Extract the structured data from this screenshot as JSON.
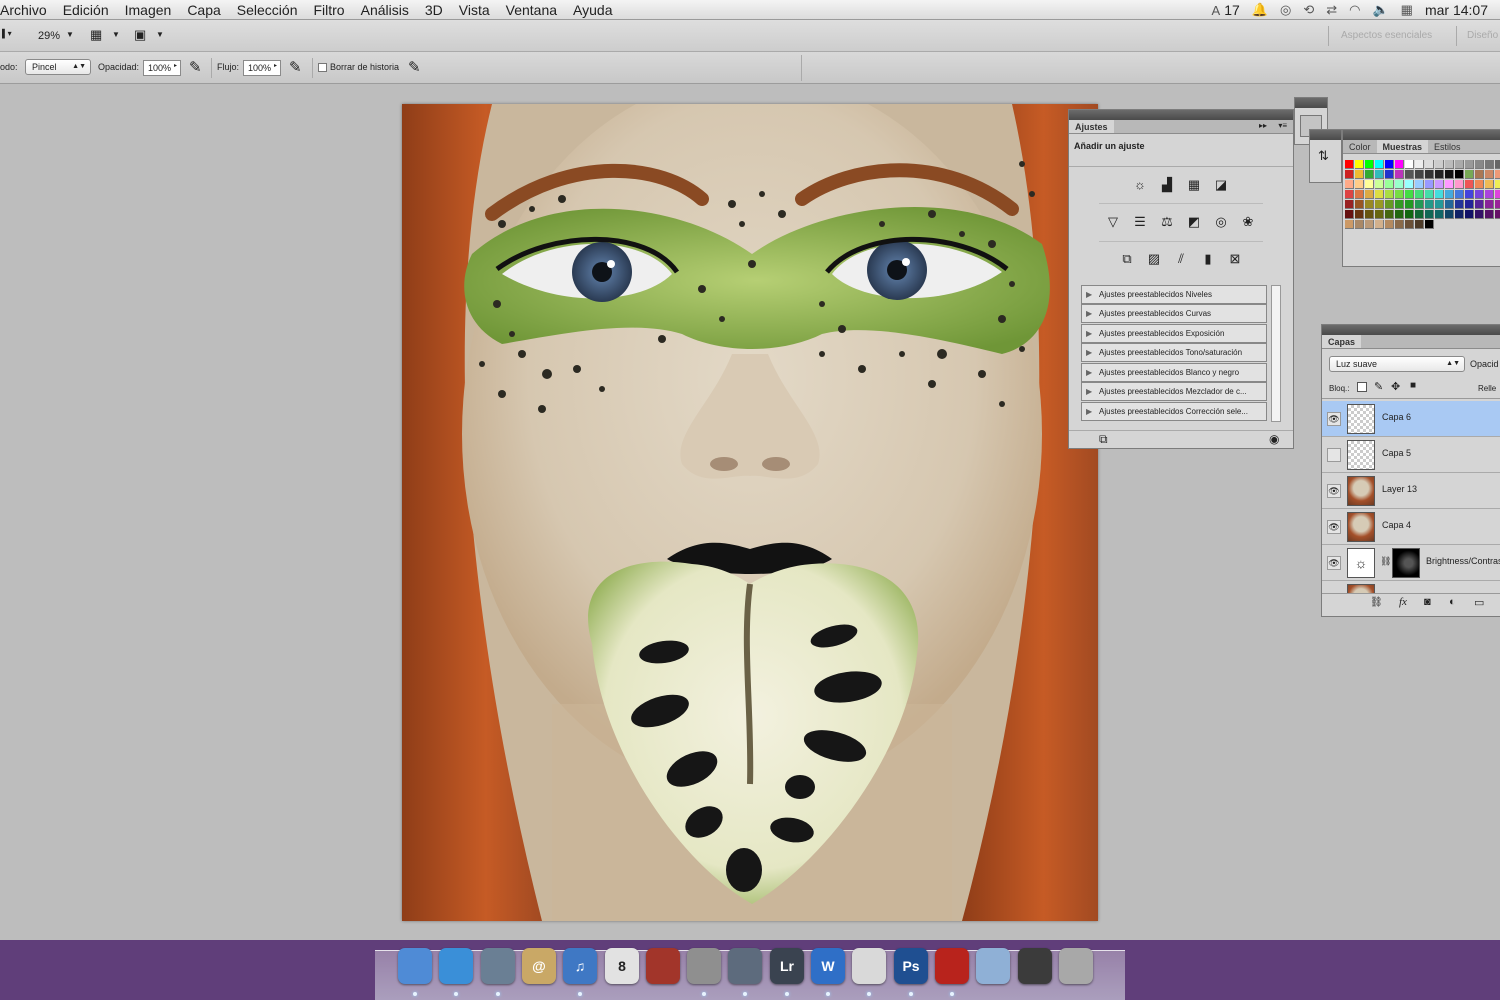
{
  "menubar": {
    "items": [
      "Archivo",
      "Edición",
      "Imagen",
      "Capa",
      "Selección",
      "Filtro",
      "Análisis",
      "3D",
      "Vista",
      "Ventana",
      "Ayuda"
    ],
    "status": {
      "adobe_badge": "17",
      "clock": "mar 14:07"
    }
  },
  "appbar": {
    "zoom": "29%",
    "workspaces": [
      "Aspectos esenciales",
      "Diseño"
    ]
  },
  "options": {
    "mode_label": "odo:",
    "mode_value": "Pincel",
    "opacity_label": "Opacidad:",
    "opacity_value": "100%",
    "flow_label": "Flujo:",
    "flow_value": "100%",
    "erase_history_label": "Borrar de historia"
  },
  "adjustments_panel": {
    "tab": "Ajustes",
    "header": "Añadir un ajuste",
    "presets": [
      "Ajustes preestablecidos Niveles",
      "Ajustes preestablecidos Curvas",
      "Ajustes preestablecidos Exposición",
      "Ajustes preestablecidos Tono/saturación",
      "Ajustes preestablecidos Blanco y negro",
      "Ajustes preestablecidos Mezclador de c...",
      "Ajustes preestablecidos Corrección sele..."
    ]
  },
  "swatches_panel": {
    "tabs": [
      "Color",
      "Muestras",
      "Estilos"
    ],
    "active_tab": "Muestras"
  },
  "layers_panel": {
    "tab": "Capas",
    "blend_mode": "Luz suave",
    "opacity_label": "Opacid",
    "lock_label": "Bloq.:",
    "fill_label": "Relle",
    "layers": [
      {
        "name": "Capa 6",
        "visible": true,
        "selected": true
      },
      {
        "name": "Capa 5",
        "visible": false,
        "selected": false
      },
      {
        "name": "Layer 13",
        "visible": true,
        "selected": false
      },
      {
        "name": "Capa 4",
        "visible": true,
        "selected": false
      },
      {
        "name": "Brightness/Contras",
        "visible": true,
        "selected": false
      }
    ]
  },
  "dock": {
    "apps": [
      {
        "name": "Finder",
        "label": "",
        "color": "#4f8bd6"
      },
      {
        "name": "Safari",
        "label": "",
        "color": "#3a8fd8"
      },
      {
        "name": "iPhoto",
        "label": "",
        "color": "#6a7f94"
      },
      {
        "name": "Contacts",
        "label": "@",
        "color": "#c9a866"
      },
      {
        "name": "iTunes",
        "label": "♫",
        "color": "#3f78c4"
      },
      {
        "name": "Calendar",
        "label": "8",
        "color": "#e2e2e2"
      },
      {
        "name": "Photo Booth",
        "label": "",
        "color": "#a2352a"
      },
      {
        "name": "System Preferences",
        "label": "",
        "color": "#8f8f8f"
      },
      {
        "name": "Time Machine",
        "label": "",
        "color": "#5d6b7d"
      },
      {
        "name": "Lightroom",
        "label": "Lr",
        "color": "#3a4350"
      },
      {
        "name": "Word",
        "label": "W",
        "color": "#2f6fc7"
      },
      {
        "name": "Chrome",
        "label": "",
        "color": "#d9d9d9"
      },
      {
        "name": "Photoshop",
        "label": "Ps",
        "color": "#1f4f91"
      },
      {
        "name": "Acrobat",
        "label": "",
        "color": "#b8231c"
      },
      {
        "name": "Documents",
        "label": "",
        "color": "#8fb0d6"
      },
      {
        "name": "Preview",
        "label": "",
        "color": "#3b3b3b"
      },
      {
        "name": "Trash",
        "label": "",
        "color": "#a8a8a8"
      }
    ]
  }
}
